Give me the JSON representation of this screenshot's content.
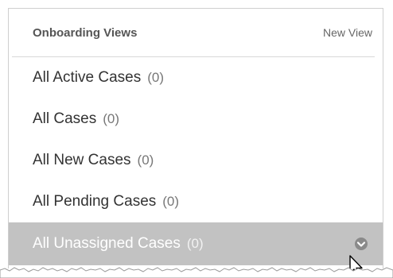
{
  "panel": {
    "title": "Onboarding Views",
    "new_view_label": "New View"
  },
  "views": [
    {
      "label": "All Active Cases",
      "count": "(0)"
    },
    {
      "label": "All Cases",
      "count": "(0)"
    },
    {
      "label": "All New Cases",
      "count": "(0)"
    },
    {
      "label": "All Pending Cases",
      "count": "(0)"
    },
    {
      "label": "All Unassigned Cases",
      "count": "(0)",
      "selected": true
    }
  ],
  "icons": {
    "dropdown": "chevron-down-circle-icon",
    "cursor": "mouse-pointer-icon"
  },
  "colors": {
    "selected_bg": "#c2c2c2",
    "text": "#333333",
    "muted": "#777777"
  }
}
